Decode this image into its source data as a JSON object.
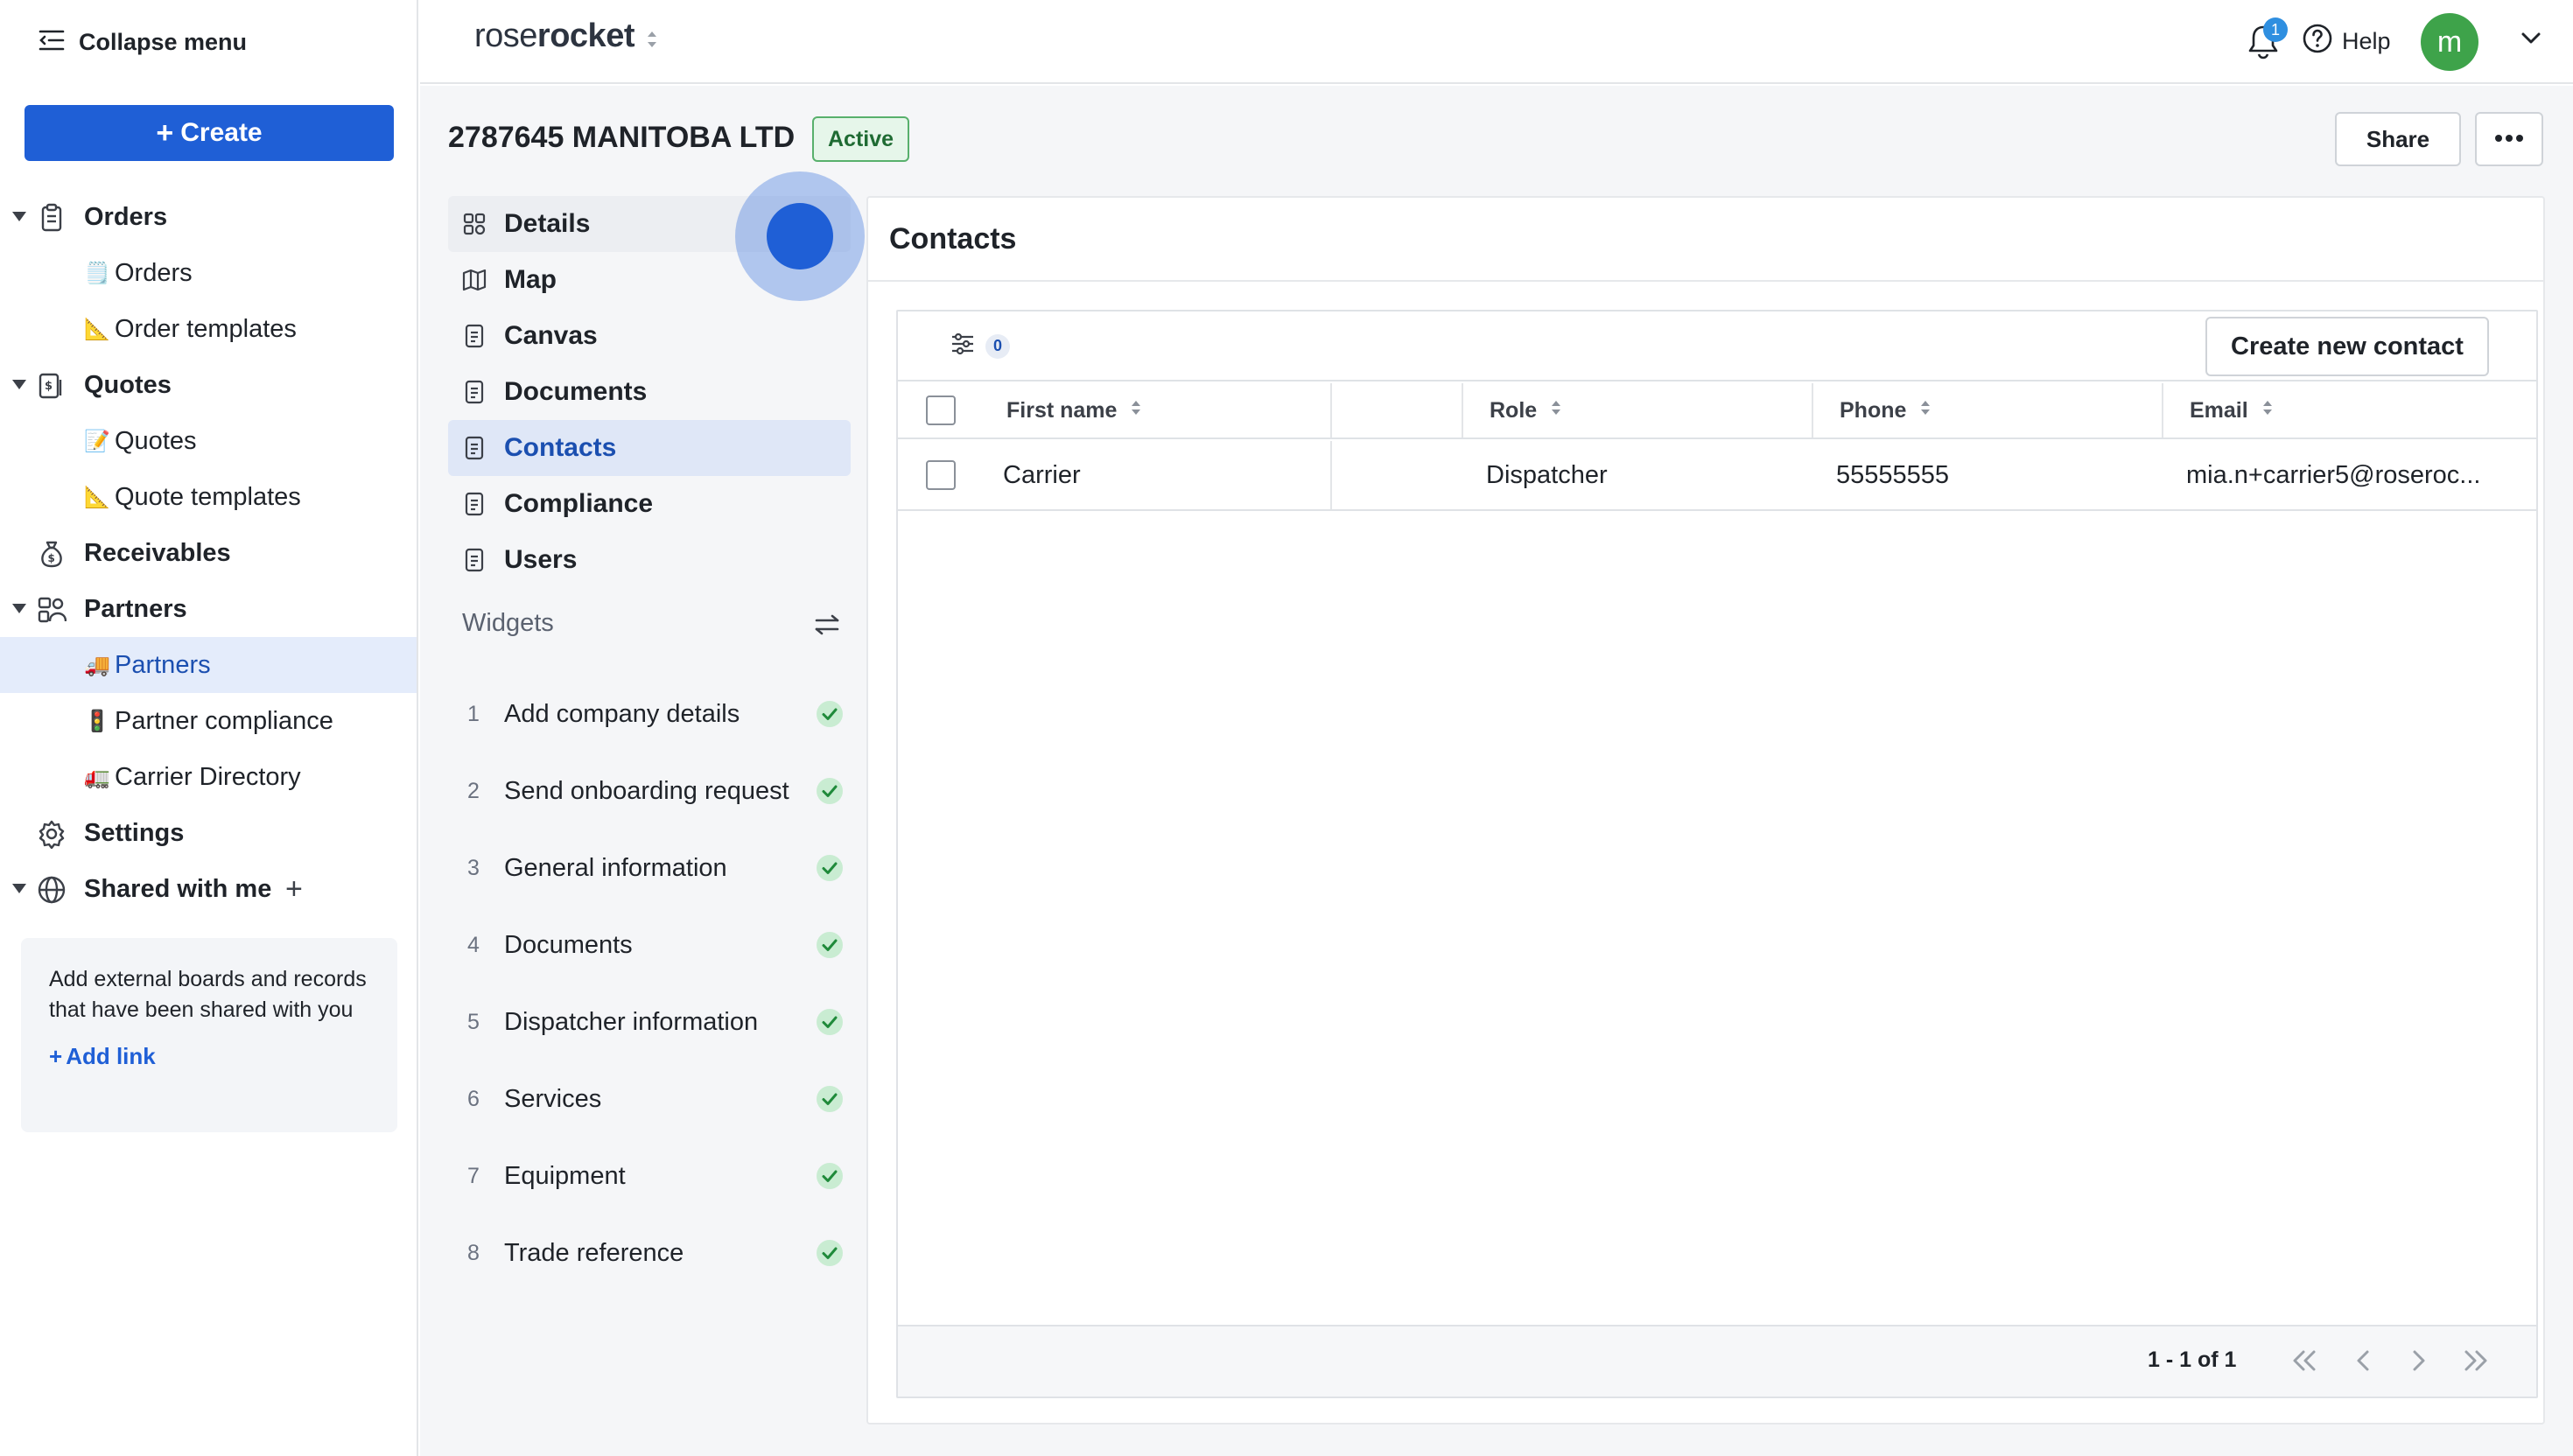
{
  "sidebar": {
    "collapse_label": "Collapse menu",
    "create_label": "Create",
    "items": [
      {
        "kind": "top",
        "label": "Orders",
        "icon": "clipboard-icon",
        "caret": true
      },
      {
        "kind": "sub",
        "label": "Orders",
        "emoji": "🗒️"
      },
      {
        "kind": "sub",
        "label": "Order templates",
        "emoji": "📐"
      },
      {
        "kind": "top",
        "label": "Quotes",
        "icon": "quote-icon",
        "caret": true
      },
      {
        "kind": "sub",
        "label": "Quotes",
        "emoji": "📝"
      },
      {
        "kind": "sub",
        "label": "Quote templates",
        "emoji": "📐"
      },
      {
        "kind": "top",
        "label": "Receivables",
        "icon": "money-bag-icon",
        "caret": false
      },
      {
        "kind": "top",
        "label": "Partners",
        "icon": "partners-icon",
        "caret": true
      },
      {
        "kind": "sub",
        "label": "Partners",
        "emoji": "🚚",
        "active": true
      },
      {
        "kind": "sub",
        "label": "Partner compliance",
        "emoji": "🚦"
      },
      {
        "kind": "sub",
        "label": "Carrier Directory",
        "emoji": "🚛"
      },
      {
        "kind": "top",
        "label": "Settings",
        "icon": "gear-icon",
        "caret": false
      },
      {
        "kind": "top",
        "label": "Shared with me",
        "icon": "globe-icon",
        "caret": true,
        "plus": true
      }
    ],
    "shared_card": {
      "description": "Add external boards and records that have been shared with you",
      "add_link": "Add link"
    }
  },
  "topbar": {
    "logo_regular": "rose",
    "logo_bold": "rocket",
    "notification_count": "1",
    "help_label": "Help",
    "avatar_initial": "m"
  },
  "record": {
    "title": "2787645 MANITOBA LTD",
    "status": "Active",
    "share_label": "Share",
    "nav": [
      {
        "label": "Details",
        "icon": "details-icon",
        "hover": true
      },
      {
        "label": "Map",
        "icon": "map-icon"
      },
      {
        "label": "Canvas",
        "icon": "document-icon"
      },
      {
        "label": "Documents",
        "icon": "document-icon"
      },
      {
        "label": "Contacts",
        "icon": "document-icon",
        "active": true
      },
      {
        "label": "Compliance",
        "icon": "document-icon"
      },
      {
        "label": "Users",
        "icon": "document-icon"
      }
    ],
    "widgets_label": "Widgets",
    "widgets": [
      {
        "num": "1",
        "label": "Add company details"
      },
      {
        "num": "2",
        "label": "Send onboarding request"
      },
      {
        "num": "3",
        "label": "General information"
      },
      {
        "num": "4",
        "label": "Documents"
      },
      {
        "num": "5",
        "label": "Dispatcher information"
      },
      {
        "num": "6",
        "label": "Services"
      },
      {
        "num": "7",
        "label": "Equipment"
      },
      {
        "num": "8",
        "label": "Trade reference"
      }
    ]
  },
  "contacts": {
    "title": "Contacts",
    "filter_count": "0",
    "create_label": "Create new contact",
    "columns": [
      "First name",
      "",
      "Role",
      "Phone",
      "Email"
    ],
    "rows": [
      {
        "first_name": "Carrier",
        "blank": "",
        "role": "Dispatcher",
        "phone": "55555555",
        "email": "mia.n+carrier5@roseroc..."
      }
    ],
    "page_info": "1 - 1 of 1"
  },
  "colors": {
    "accent": "#1f5fd6",
    "active_bg": "#e4ecfb",
    "status_green": "#3ea34a"
  }
}
